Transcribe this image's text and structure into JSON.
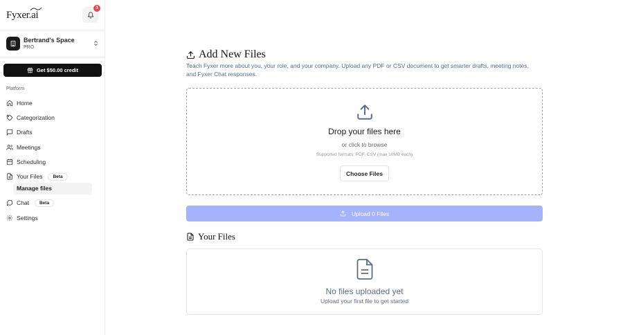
{
  "app": {
    "logo_text": "Fyxer.ai"
  },
  "notifications": {
    "count": "3"
  },
  "workspace": {
    "name": "Bertrand's Space",
    "plan": "PRO"
  },
  "credit_button": {
    "label": "Get $50.00 credit"
  },
  "sidebar": {
    "section_label": "Platform",
    "items": [
      {
        "label": "Home",
        "icon": "home-icon"
      },
      {
        "label": "Categorization",
        "icon": "tag-icon"
      },
      {
        "label": "Drafts",
        "icon": "message-square-icon"
      },
      {
        "label": "Meetings",
        "icon": "users-icon"
      },
      {
        "label": "Scheduling",
        "icon": "calendar-icon"
      },
      {
        "label": "Your Files",
        "icon": "file-icon",
        "badge": "Beta"
      },
      {
        "label": "Chat",
        "icon": "chat-bubble-icon",
        "badge": "Beta"
      },
      {
        "label": "Settings",
        "icon": "gear-icon"
      }
    ],
    "sub_items": [
      {
        "label": "Manage files"
      }
    ]
  },
  "main": {
    "title": "Add New Files",
    "description": "Teach Fyxer more about you, your role, and your company. Upload any PDF or CSV document to get smarter drafts, meeting notes, and Fyxer Chat responses.",
    "dropzone": {
      "title": "Drop your files here",
      "subtitle": "or click to browse",
      "formats": "Supported formats: PDF, CSV (max 10MB each)",
      "choose_label": "Choose Files"
    },
    "upload_button": {
      "label": "Upload 0 Files"
    },
    "files_section": {
      "title": "Your Files",
      "empty_title": "No files uploaded yet",
      "empty_subtitle": "Upload your first file to get started"
    }
  },
  "colors": {
    "upload_button": "#a4b3fa",
    "badge": "#e5484d",
    "credit_button": "#111111"
  }
}
